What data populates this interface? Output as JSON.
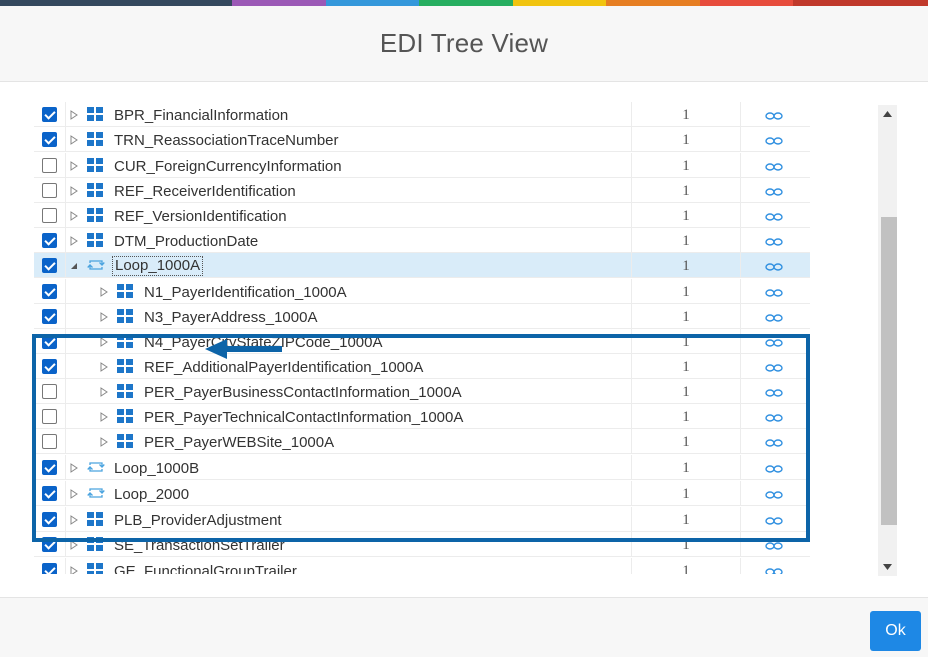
{
  "dialog": {
    "title": "EDI Tree View",
    "ok_label": "Ok",
    "top_stripe_colors": [
      "#34495e",
      "#9b59b6",
      "#3498db",
      "#27ae60",
      "#f1c40f",
      "#e67e22",
      "#e74c3c",
      "#c0392b"
    ]
  },
  "tree": {
    "rows": [
      {
        "label": "BPR_FinancialInformation",
        "checked": true,
        "icon": "segment-icon",
        "level": 0,
        "count": "1",
        "expanded": false
      },
      {
        "label": "TRN_ReassociationTraceNumber",
        "checked": true,
        "icon": "segment-icon",
        "level": 0,
        "count": "1",
        "expanded": false
      },
      {
        "label": "CUR_ForeignCurrencyInformation",
        "checked": false,
        "icon": "segment-icon",
        "level": 0,
        "count": "1",
        "expanded": false
      },
      {
        "label": "REF_ReceiverIdentification",
        "checked": false,
        "icon": "segment-icon",
        "level": 0,
        "count": "1",
        "expanded": false
      },
      {
        "label": "REF_VersionIdentification",
        "checked": false,
        "icon": "segment-icon",
        "level": 0,
        "count": "1",
        "expanded": false
      },
      {
        "label": "DTM_ProductionDate",
        "checked": true,
        "icon": "segment-icon",
        "level": 0,
        "count": "1",
        "expanded": false
      },
      {
        "label": "Loop_1000A",
        "checked": true,
        "icon": "loop-icon",
        "level": 0,
        "count": "1",
        "expanded": true,
        "selected": true
      },
      {
        "label": "N1_PayerIdentification_1000A",
        "checked": true,
        "icon": "segment-icon",
        "level": 1,
        "count": "1",
        "expanded": false
      },
      {
        "label": "N3_PayerAddress_1000A",
        "checked": true,
        "icon": "segment-icon",
        "level": 1,
        "count": "1",
        "expanded": false
      },
      {
        "label": "N4_PayerCityStateZIPCode_1000A",
        "checked": true,
        "icon": "segment-icon",
        "level": 1,
        "count": "1",
        "expanded": false
      },
      {
        "label": "REF_AdditionalPayerIdentification_1000A",
        "checked": true,
        "icon": "segment-icon",
        "level": 1,
        "count": "1",
        "expanded": false
      },
      {
        "label": "PER_PayerBusinessContactInformation_1000A",
        "checked": false,
        "icon": "segment-icon",
        "level": 1,
        "count": "1",
        "expanded": false
      },
      {
        "label": "PER_PayerTechnicalContactInformation_1000A",
        "checked": false,
        "icon": "segment-icon",
        "level": 1,
        "count": "1",
        "expanded": false
      },
      {
        "label": "PER_PayerWEBSite_1000A",
        "checked": false,
        "icon": "segment-icon",
        "level": 1,
        "count": "1",
        "expanded": false
      },
      {
        "label": "Loop_1000B",
        "checked": true,
        "icon": "loop-icon",
        "level": 0,
        "count": "1",
        "expanded": false
      },
      {
        "label": "Loop_2000",
        "checked": true,
        "icon": "loop-icon",
        "level": 0,
        "count": "1",
        "expanded": false
      },
      {
        "label": "PLB_ProviderAdjustment",
        "checked": true,
        "icon": "segment-icon",
        "level": 0,
        "count": "1",
        "expanded": false
      },
      {
        "label": "SE_TransactionSetTrailer",
        "checked": true,
        "icon": "segment-icon",
        "level": 0,
        "count": "1",
        "expanded": false
      },
      {
        "label": "GE_FunctionalGroupTrailer",
        "checked": true,
        "icon": "segment-icon",
        "level": 0,
        "count": "1",
        "expanded": false
      }
    ]
  }
}
